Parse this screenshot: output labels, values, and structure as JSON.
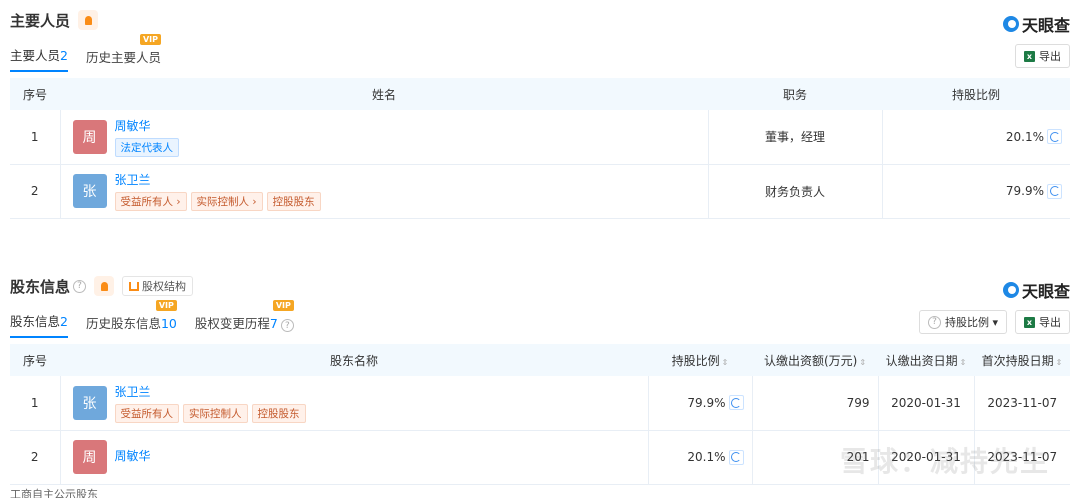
{
  "brand": "天眼查",
  "section1": {
    "title": "主要人员",
    "tabs": [
      {
        "label": "主要人员",
        "count": "2",
        "vip": ""
      },
      {
        "label": "历史主要人员",
        "count": "",
        "vip": "VIP"
      }
    ],
    "export_label": "导出",
    "columns": [
      "序号",
      "姓名",
      "职务",
      "持股比例"
    ],
    "rows": [
      {
        "no": "1",
        "avatar": "周",
        "name": "周敏华",
        "tags": [
          "法定代表人"
        ],
        "role": "董事，经理",
        "ratio": "20.1%"
      },
      {
        "no": "2",
        "avatar": "张",
        "name": "张卫兰",
        "tags": [
          "受益所有人 ›",
          "实际控制人 ›",
          "控股股东"
        ],
        "role": "财务负责人",
        "ratio": "79.9%"
      }
    ]
  },
  "section2": {
    "title": "股东信息",
    "struct_label": "股权结构",
    "tabs": [
      {
        "label": "股东信息",
        "count": "2",
        "vip": ""
      },
      {
        "label": "历史股东信息",
        "count": "10",
        "vip": "VIP"
      },
      {
        "label": "股权变更历程",
        "count": "7",
        "vip": "VIP"
      }
    ],
    "ratio_filter_label": "持股比例 ▾",
    "export_label": "导出",
    "columns": [
      "序号",
      "股东名称",
      "持股比例",
      "认缴出资额(万元)",
      "认缴出资日期",
      "首次持股日期"
    ],
    "rows": [
      {
        "no": "1",
        "avatar": "张",
        "name": "张卫兰",
        "tags": [
          "受益所有人",
          "实际控制人",
          "控股股东"
        ],
        "ratio": "79.9%",
        "amount": "799",
        "date": "2020-01-31",
        "first": "2023-11-07"
      },
      {
        "no": "2",
        "avatar": "周",
        "name": "周敏华",
        "tags": [],
        "ratio": "20.1%",
        "amount": "201",
        "date": "2020-01-31",
        "first": "2023-11-07"
      }
    ]
  },
  "watermark": "雪球：减持先生",
  "footer": "工商自主公示股东",
  "colors": {
    "zhou": "#d9777a",
    "zhang": "#6fa8dc",
    "accent": "#0084ff"
  }
}
